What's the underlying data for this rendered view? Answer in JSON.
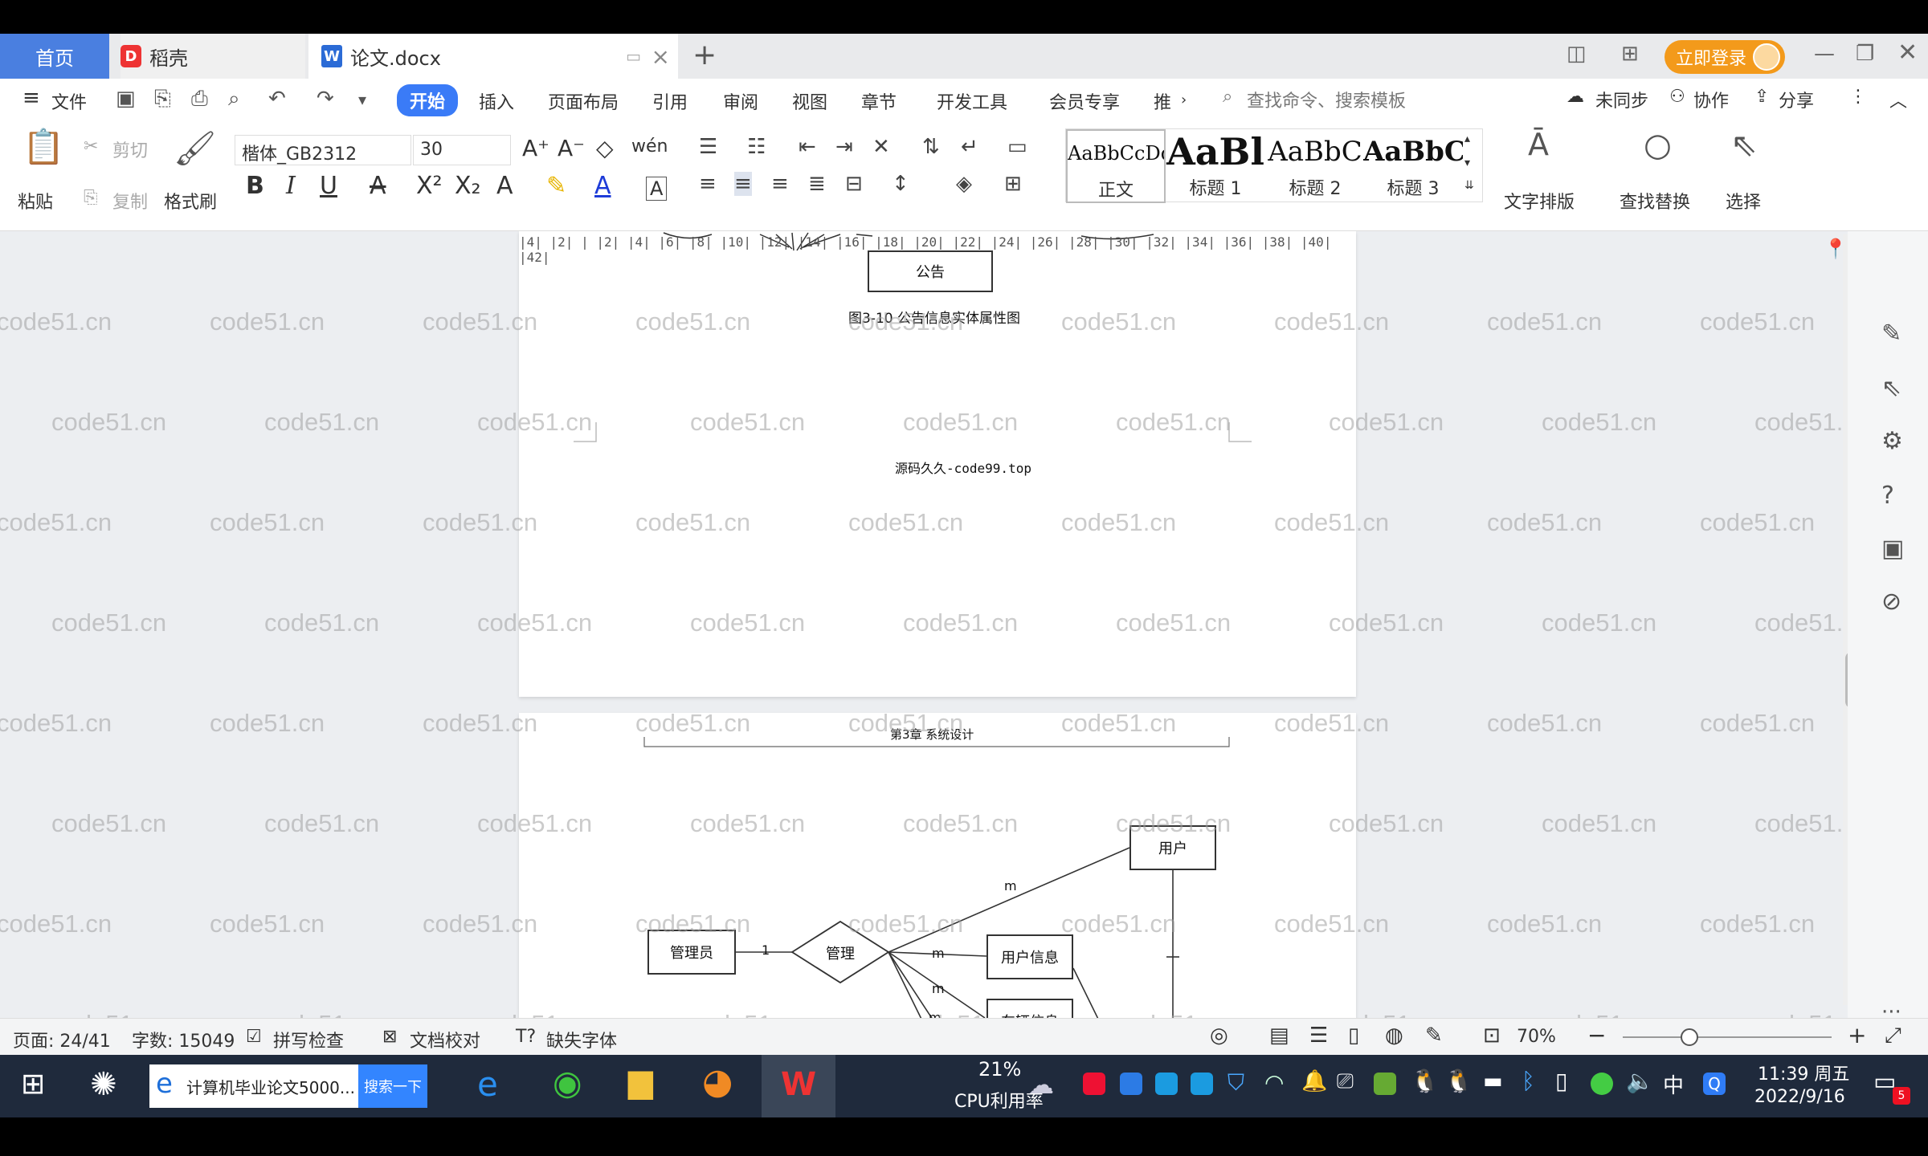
{
  "tabs": {
    "home": "首页",
    "daoke": "稻壳",
    "doc": "论文.docx",
    "login": "立即登录"
  },
  "menu": {
    "file": "文件",
    "items": [
      "开始",
      "插入",
      "页面布局",
      "引用",
      "审阅",
      "视图",
      "章节",
      "开发工具",
      "会员专享",
      "推"
    ],
    "search": "查找命令、搜索模板",
    "sync": "未同步",
    "collab": "协作",
    "share": "分享"
  },
  "ribbon": {
    "paste": "粘贴",
    "cut": "剪切",
    "copy": "复制",
    "format_painter": "格式刷",
    "font": "楷体_GB2312",
    "size": "30",
    "styles": [
      {
        "sample": "AaBbCcDd",
        "label": "正文"
      },
      {
        "sample": "AaBl",
        "label": "标题 1"
      },
      {
        "sample": "AaBbC",
        "label": "标题 2"
      },
      {
        "sample": "AaBbC",
        "label": "标题 3"
      }
    ],
    "text_layout": "文字排版",
    "find_replace": "查找替换",
    "select": "选择"
  },
  "ruler": "|4| |2| |  |2| |4| |6| |8| |10| |12| |14| |16| |18| |20| |22| |24| |26| |28| |30| |32| |34| |36| |38| |40| |42|",
  "doc": {
    "entity_notice": "公告",
    "fig_caption": "图3-10 公告信息实体属性图",
    "footer": "源码久久-code99.top",
    "chapter_header": "第3章 系统设计",
    "er": {
      "user": "用户",
      "admin": "管理员",
      "manage": "管理",
      "user_info": "用户信息",
      "car_info": "车辆信息",
      "one": "1",
      "m1": "m",
      "m2": "m",
      "m3": "m",
      "m4": "m"
    },
    "watermark": "code51.cn"
  },
  "status": {
    "page": "页面: 24/41",
    "words": "字数: 15049",
    "spell": "拼写检查",
    "proof": "文档校对",
    "missing_font": "缺失字体",
    "zoom": "70%"
  },
  "taskbar": {
    "search_text": "计算机毕业论文5000...",
    "search_btn": "搜索一下",
    "cpu_pct": "21%",
    "cpu_label": "CPU利用率",
    "ime": "中",
    "time": "11:39 周五",
    "date": "2022/9/16",
    "notify_count": "5"
  }
}
